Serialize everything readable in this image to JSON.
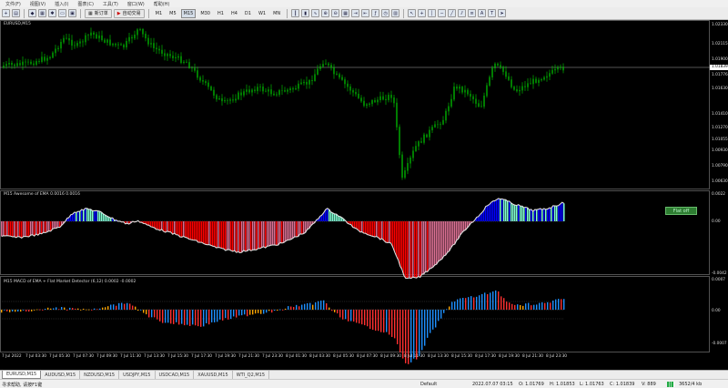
{
  "menu": {
    "items": [
      "文件(F)",
      "视图(V)",
      "插入(I)",
      "图表(C)",
      "工具(T)",
      "窗口(W)",
      "帮助(H)"
    ]
  },
  "toolbar": {
    "new_order_label": "新订单",
    "auto_trading_label": "自动交易",
    "timeframes": [
      "M1",
      "M5",
      "M15",
      "M30",
      "H1",
      "H4",
      "D1",
      "W1",
      "MN"
    ],
    "active_timeframe": "M15"
  },
  "chart": {
    "symbol_label": "EURUSD,M15",
    "bid_price": "1.01839",
    "price_axis": [
      "1.02330",
      "1.02115",
      "1.01900",
      "1.01776",
      "1.01630",
      "1.01410",
      "1.01270",
      "1.01055",
      "1.00930",
      "1.00790",
      "1.00630"
    ],
    "ao_pane_label": "M15 Awesome of EMA 0.0016 0.0016",
    "ao_axis": [
      "0.0022",
      "0.00",
      "-0.0042"
    ],
    "macd_pane_label": "M15 MACD of EMA + Flat Market Detector (6,12) 0.0002 -0.0002",
    "macd_axis": [
      "0.0007",
      "0.00",
      "-0.0007"
    ],
    "flat_button_label": "Flat off",
    "time_axis": [
      "7 Jul 2022",
      "7 Jul 03:30",
      "7 Jul 05:30",
      "7 Jul 07:30",
      "7 Jul 09:30",
      "7 Jul 11:30",
      "7 Jul 13:30",
      "7 Jul 15:30",
      "7 Jul 17:30",
      "7 Jul 19:30",
      "7 Jul 21:30",
      "7 Jul 23:30",
      "8 Jul 01:30",
      "8 Jul 03:30",
      "8 Jul 05:30",
      "8 Jul 07:30",
      "8 Jul 09:30",
      "8 Jul 11:30",
      "8 Jul 13:30",
      "8 Jul 15:30",
      "8 Jul 17:30",
      "8 Jul 19:30",
      "8 Jul 21:30",
      "8 Jul 23:30"
    ]
  },
  "tabs": [
    "EURUSD,M15",
    "AUDUSD,M15",
    "NZDUSD,M15",
    "USDJPY,M15",
    "USDCAD,M15",
    "XAUUSD,M15",
    "WTI_Q2,M15"
  ],
  "active_tab": "EURUSD,M15",
  "status": {
    "help_text": "寻求帮助, 请按F1键",
    "profile": "Default",
    "datetime": "2022.07.07 03:15",
    "open": "O: 1.01769",
    "high": "H: 1.01853",
    "low": "L: 1.01763",
    "close": "C: 1.01839",
    "volume": "V: 889",
    "traffic": "3652/4 kb"
  },
  "colors": {
    "candles": "#00d000",
    "ao_up": "#0000ff",
    "ao_up_weak": "#7fffd4",
    "ao_down": "#ff0000",
    "ao_down_weak": "#db7093",
    "macd_up": "#1e90ff",
    "macd_down": "#ff3030",
    "macd_flat": "#ffa500"
  }
}
